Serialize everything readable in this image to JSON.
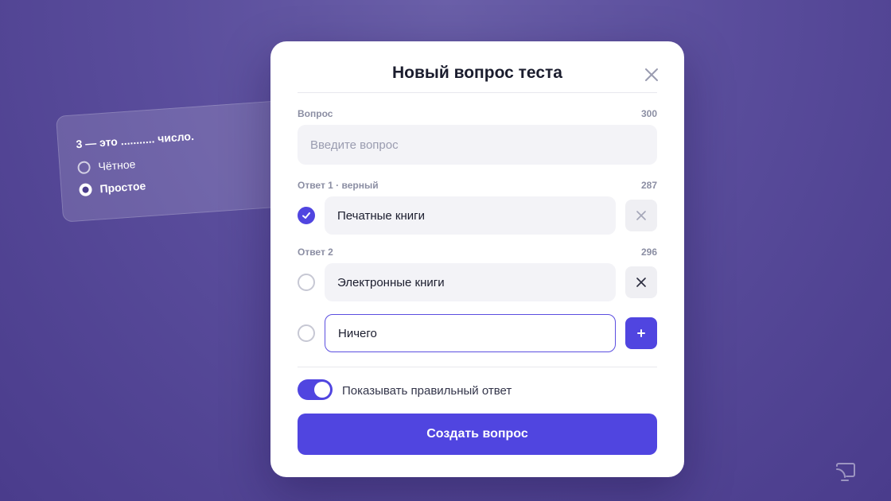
{
  "background_card": {
    "question": "3 — это ........... число.",
    "options": [
      {
        "label": "Чётное",
        "selected": false
      },
      {
        "label": "Простое",
        "selected": true
      }
    ]
  },
  "modal": {
    "title": "Новый вопрос теста",
    "question": {
      "label": "Вопрос",
      "count": "300",
      "placeholder": "Введите вопрос",
      "value": ""
    },
    "answers": [
      {
        "label": "Ответ 1 · верный",
        "count": "287",
        "value": "Печатные книги",
        "correct": true
      },
      {
        "label": "Ответ 2",
        "count": "296",
        "value": "Электронные книги",
        "correct": false
      },
      {
        "label": "",
        "count": "",
        "value": "Ничего",
        "correct": false
      }
    ],
    "toggle": {
      "label": "Показывать правильный ответ",
      "on": true
    },
    "submit_label": "Создать вопрос"
  },
  "colors": {
    "accent": "#5045e0",
    "background": "#5a4d9c"
  },
  "icons": {
    "close": "close-icon",
    "remove": "x-icon",
    "add": "plus-icon",
    "corner": "cast-icon"
  }
}
